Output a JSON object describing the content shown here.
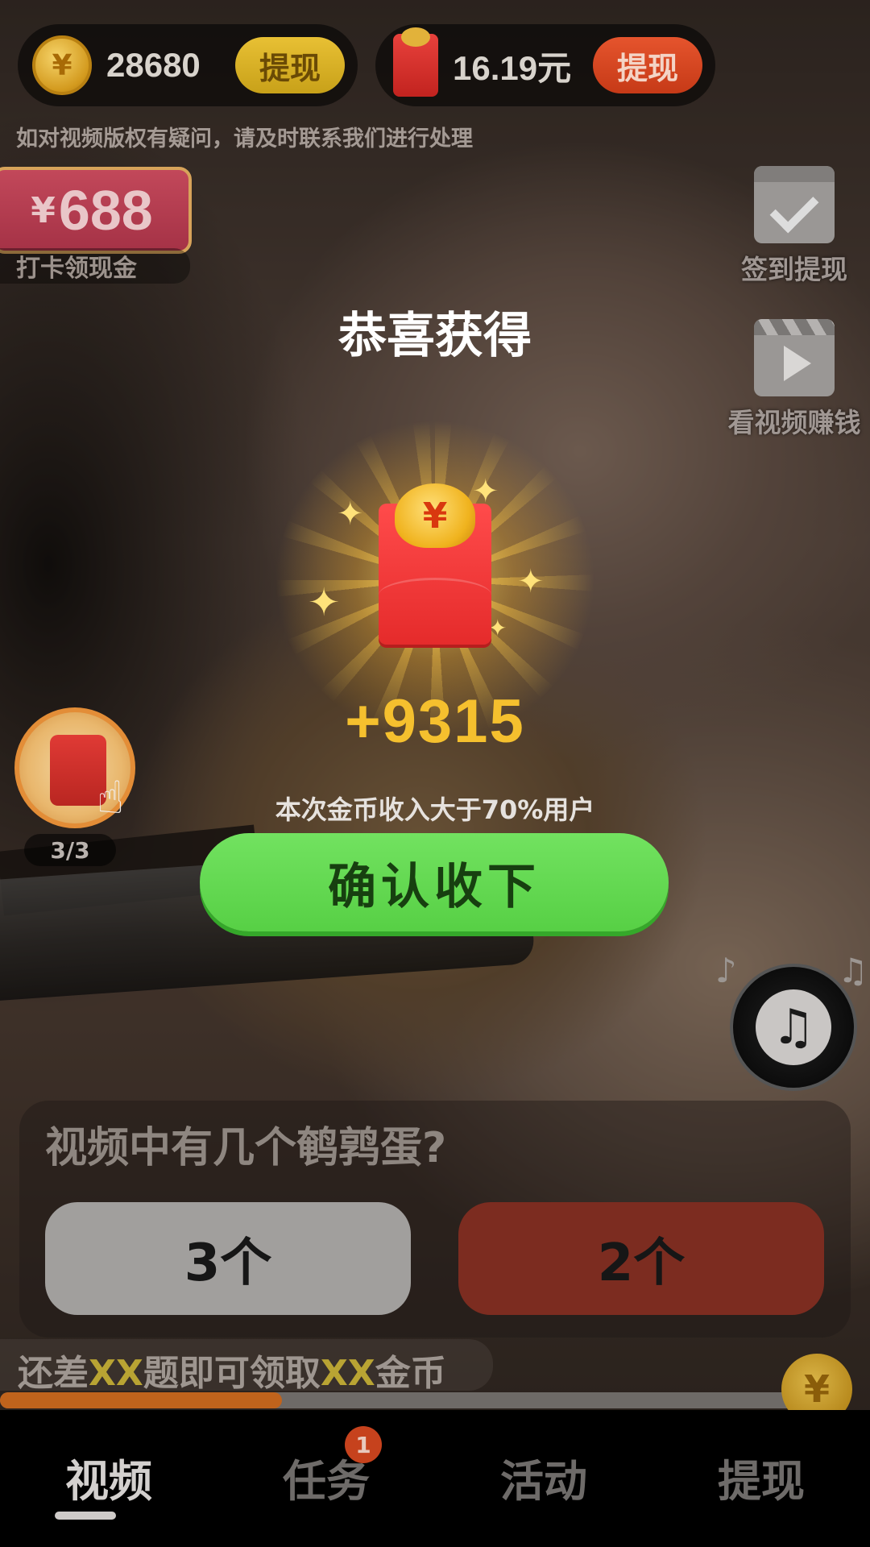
{
  "header": {
    "coins": {
      "icon": "yen-coin-icon",
      "value": "28680",
      "button": "提现"
    },
    "cash": {
      "icon": "red-envelope-icon",
      "value": "16.19元",
      "button": "提现"
    },
    "notice": "如对视频版权有疑问，请及时联系我们进行处理"
  },
  "reward_tag": {
    "currency": "¥",
    "amount": "688",
    "label": "打卡领现金"
  },
  "side": {
    "checkin": {
      "icon": "calendar-check-icon",
      "label": "签到提现"
    },
    "watch": {
      "icon": "clapperboard-play-icon",
      "label": "看视频赚钱"
    }
  },
  "popup": {
    "title": "恭喜获得",
    "coin_symbol": "¥",
    "bonus": "+9315",
    "subtitle": "本次金币收入大于70%用户",
    "confirm": "确认收下"
  },
  "floating_bag": {
    "count": "3/3"
  },
  "quiz": {
    "question": "视频中有几个鹌鹑蛋?",
    "answers": [
      "3个",
      "2个"
    ]
  },
  "progress": {
    "prefix": "还差",
    "hl1": "XX",
    "mid": "题即可领取",
    "hl2": "XX",
    "suffix": "金币",
    "fraction": 0.35,
    "coin_symbol": "¥"
  },
  "nav": {
    "items": [
      "视频",
      "任务",
      "活动",
      "提现"
    ],
    "active": 0,
    "task_badge": "1"
  },
  "colors": {
    "confirm_green": "#62d94f",
    "bonus_gold": "#f5c02e",
    "progress_orange": "#c0631c",
    "answer_red": "#7c2c20"
  }
}
